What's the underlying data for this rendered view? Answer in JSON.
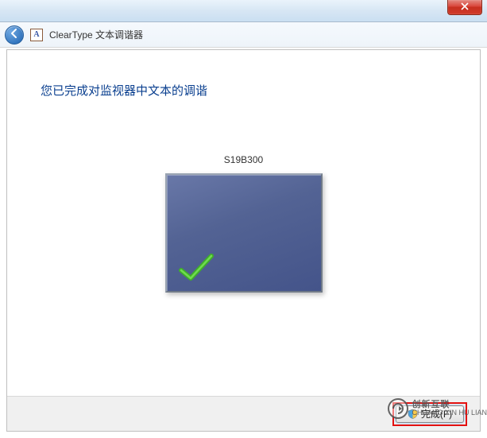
{
  "window": {
    "title": "ClearType 文本调谐器",
    "app_icon_letter": "A"
  },
  "content": {
    "heading": "您已完成对监视器中文本的调谐",
    "monitor_name": "S19B300"
  },
  "footer": {
    "finish_label": "完成(F)"
  },
  "watermark": {
    "line1": "创新互联",
    "line2": "CHUANG XIN HU LIAN"
  }
}
